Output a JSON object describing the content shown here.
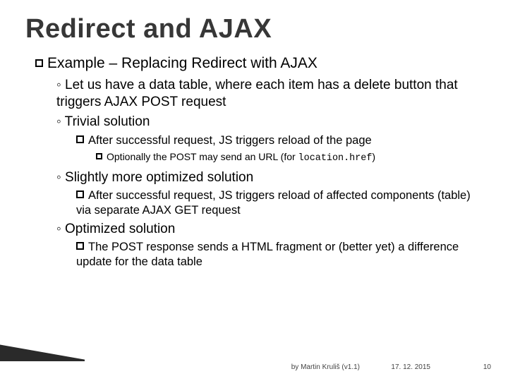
{
  "title": "Redirect and AJAX",
  "lvl1": {
    "lead": "Example",
    "rest": " – Replacing Redirect with AJAX"
  },
  "b1": "Let us have a data table, where each item has a delete button that triggers AJAX POST request",
  "b2": "Trivial solution",
  "b2a": "After successful request, JS triggers reload of the page",
  "b2a1_pre": "Optionally the POST may send an URL (for ",
  "b2a1_code": "location.href",
  "b2a1_post": ")",
  "b3": "Slightly more optimized solution",
  "b3a": "After successful request, JS triggers reload of affected components (table) via separate AJAX GET request",
  "b4": "Optimized solution",
  "b4a": "The POST response sends a HTML fragment or (better yet) a difference update for the data table",
  "footer": {
    "byline": "by Martin Kruliš (v1.1)",
    "date": "17. 12. 2015",
    "pagenum": "10"
  }
}
